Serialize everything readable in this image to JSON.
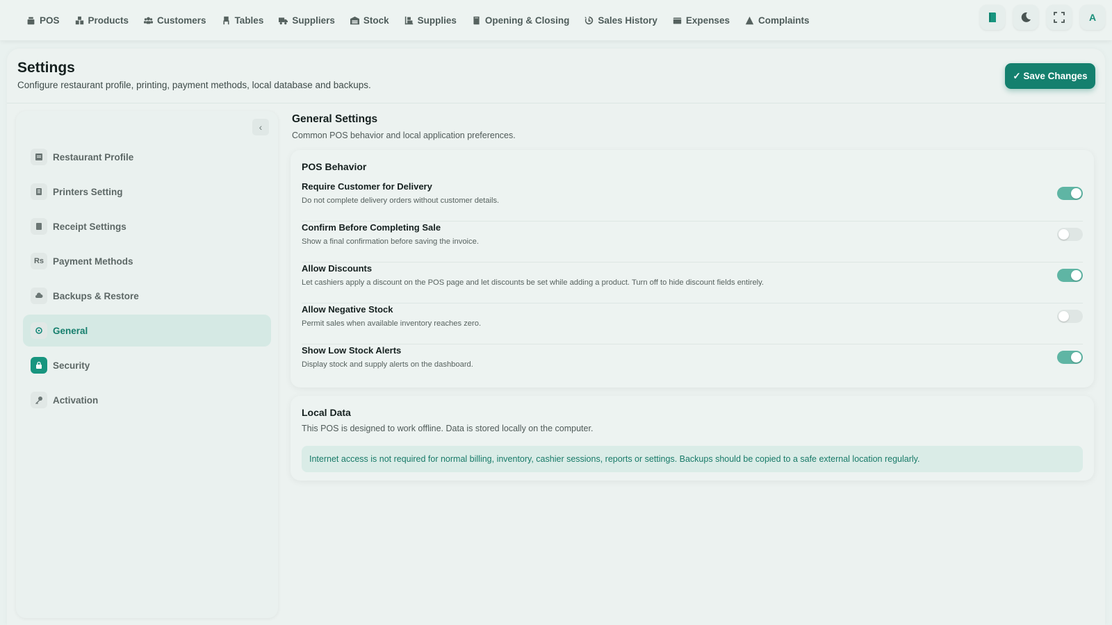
{
  "nav": {
    "items": [
      {
        "label": "POS",
        "icon": "register-icon"
      },
      {
        "label": "Products",
        "icon": "boxes-icon"
      },
      {
        "label": "Customers",
        "icon": "users-icon"
      },
      {
        "label": "Tables",
        "icon": "chair-icon"
      },
      {
        "label": "Suppliers",
        "icon": "truck-icon"
      },
      {
        "label": "Stock",
        "icon": "warehouse-icon"
      },
      {
        "label": "Supplies",
        "icon": "dolly-icon"
      },
      {
        "label": "Opening & Closing",
        "icon": "book-icon"
      },
      {
        "label": "Sales History",
        "icon": "history-icon"
      },
      {
        "label": "Expenses",
        "icon": "wallet-icon"
      },
      {
        "label": "Complaints",
        "icon": "warning-icon"
      }
    ],
    "avatar_initial": "A"
  },
  "header": {
    "title": "Settings",
    "subtitle": "Configure restaurant profile, printing, payment methods, local database and backups.",
    "save_label": "✓ Save Changes"
  },
  "sidebar": {
    "collapse_glyph": "‹",
    "items": [
      {
        "label": "Restaurant Profile",
        "icon": "storefront-icon",
        "active": false
      },
      {
        "label": "Printers Setting",
        "icon": "printer-icon",
        "active": false
      },
      {
        "label": "Receipt Settings",
        "icon": "receipt-icon",
        "active": false
      },
      {
        "label": "Payment Methods",
        "icon": "rupee-icon",
        "icon_text": "Rs",
        "active": false
      },
      {
        "label": "Backups & Restore",
        "icon": "cloud-icon",
        "active": false
      },
      {
        "label": "General",
        "icon": "gear-icon",
        "active": true
      },
      {
        "label": "Security",
        "icon": "lock-icon",
        "active": false
      },
      {
        "label": "Activation",
        "icon": "key-icon",
        "active": false
      }
    ]
  },
  "content": {
    "title": "General Settings",
    "subtitle": "Common POS behavior and local application preferences.",
    "pos_behavior": {
      "title": "POS Behavior",
      "settings": [
        {
          "title": "Require Customer for Delivery",
          "desc": "Do not complete delivery orders without customer details.",
          "enabled": true
        },
        {
          "title": "Confirm Before Completing Sale",
          "desc": "Show a final confirmation before saving the invoice.",
          "enabled": false
        },
        {
          "title": "Allow Discounts",
          "desc": "Let cashiers apply a discount on the POS page and let discounts be set while adding a product. Turn off to hide discount fields entirely.",
          "enabled": true
        },
        {
          "title": "Allow Negative Stock",
          "desc": "Permit sales when available inventory reaches zero.",
          "enabled": false
        },
        {
          "title": "Show Low Stock Alerts",
          "desc": "Display stock and supply alerts on the dashboard.",
          "enabled": true
        }
      ]
    },
    "local_data": {
      "title": "Local Data",
      "desc": "This POS is designed to work offline. Data is stored locally on the computer.",
      "info": "Internet access is not required for normal billing, inventory, cashier sessions, reports or settings. Backups should be copied to a safe external location regularly."
    }
  },
  "colors": {
    "accent": "#14806e",
    "toggle_on": "#5fb5a4",
    "toggle_off": "#dfe6e4",
    "background": "#e9f1ef"
  }
}
